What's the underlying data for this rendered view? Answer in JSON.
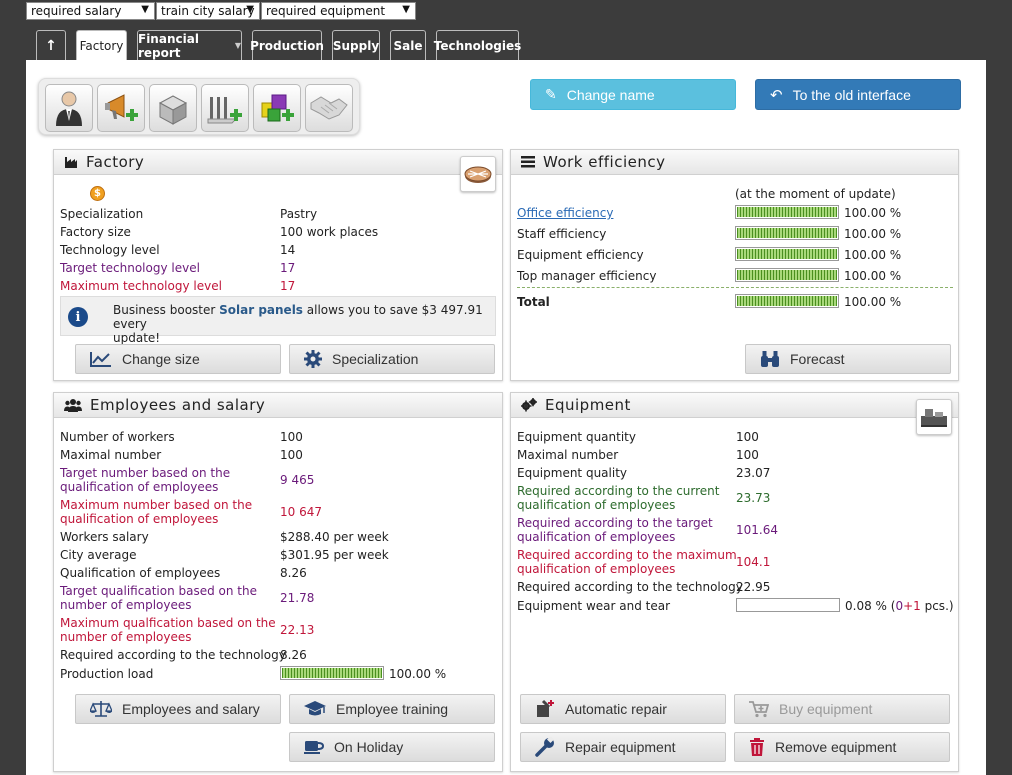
{
  "filters": [
    "required salary",
    "train city salary",
    "required equipment"
  ],
  "tabs": {
    "up_arrow": "↑",
    "items": [
      "Factory",
      "Financial report",
      "Production",
      "Supply",
      "Sale",
      "Technologies"
    ],
    "active": "Factory"
  },
  "toolbar_icons": [
    "manager-icon",
    "advertising-icon",
    "warehouse-icon",
    "equipment-add-icon",
    "product-add-icon",
    "handshake-icon"
  ],
  "top_buttons": {
    "change_name": "Change name",
    "old_interface": "To the old interface"
  },
  "factory": {
    "title": "Factory",
    "rows": [
      {
        "label": "Specialization",
        "value": "Pastry"
      },
      {
        "label": "Factory size",
        "value": "100 work places"
      },
      {
        "label": "Technology level",
        "value": "14"
      },
      {
        "label": "Target technology level",
        "value": "17"
      },
      {
        "label": "Maximum technology level",
        "value": "17"
      }
    ],
    "booster_prefix": "Business booster ",
    "booster_name": "Solar panels",
    "booster_suffix": " allows you to save $3 497.91 every",
    "booster_line2": "update!",
    "btn_change_size": "Change size",
    "btn_specialization": "Specialization"
  },
  "efficiency": {
    "title": "Work efficiency",
    "note": "(at the moment of update)",
    "rows": [
      {
        "label": "Office efficiency",
        "value": "100.00 %",
        "level": 1.0
      },
      {
        "label": "Staff efficiency",
        "value": "100.00 %",
        "level": 1.0
      },
      {
        "label": "Equipment efficiency",
        "value": "100.00 %",
        "level": 1.0
      },
      {
        "label": "Top manager efficiency",
        "value": "100.00 %",
        "level": 1.0
      }
    ],
    "total_label": "Total",
    "total_value": "100.00 %",
    "total_level": 1.0,
    "btn_forecast": "Forecast"
  },
  "employees": {
    "title": "Employees and salary",
    "rows": [
      {
        "label": "Number of workers",
        "value": "100"
      },
      {
        "label": "Maximal number",
        "value": "100"
      },
      {
        "label": "Target number based on the",
        "label2": "qualification of employees",
        "value": "9 465"
      },
      {
        "label": "Maximum number based on the",
        "label2": "qualification of employees",
        "value": "10 647"
      },
      {
        "label": "Workers salary",
        "value": "$288.40 per week"
      },
      {
        "label": "City average",
        "value": "$301.95 per week"
      },
      {
        "label": "Qualification of employees",
        "value": "8.26"
      },
      {
        "label": "Target qualification based on the",
        "label2": "number of employees",
        "value": "21.78"
      },
      {
        "label": "Maximum qualfication based on the",
        "label2": "number of employees",
        "value": "22.13"
      },
      {
        "label": "Required according to the technology",
        "value": "8.26"
      }
    ],
    "load_label": "Production load",
    "load_value": "100.00 %",
    "load_level": 1.0,
    "btn_employees": "Employees and salary",
    "btn_training": "Employee training",
    "btn_holiday": "On Holiday"
  },
  "equipment": {
    "title": "Equipment",
    "rows": [
      {
        "label": "Equipment quantity",
        "value": "100"
      },
      {
        "label": "Maximal number",
        "value": "100"
      },
      {
        "label": "Equipment quality",
        "value": "23.07"
      },
      {
        "label": "Required according to the current",
        "label2": "qualification of employees",
        "value": "23.73"
      },
      {
        "label": "Required according to the target",
        "label2": "qualification of employees",
        "value": "101.64"
      },
      {
        "label": "Required according to the maximum",
        "label2": "qualification of employees",
        "value": "104.1"
      },
      {
        "label": "Required according to the technology",
        "value": "22.95"
      }
    ],
    "wear_label": "Equipment wear and tear",
    "wear_value": "0.08 %",
    "wear_open": " (",
    "wear_zero": "0",
    "wear_plus": "+1",
    "wear_close": " pcs.)",
    "wear_level": 0.0008,
    "btn_auto_repair": "Automatic repair",
    "btn_buy": "Buy equipment",
    "btn_repair": "Repair equipment",
    "btn_remove": "Remove equipment"
  },
  "colors": {
    "change_name_bg": "#5bc0de",
    "old_interface_bg": "#337ab7",
    "purple": "#6a1a7a",
    "red": "#c0163a",
    "green": "#2d6b2d"
  }
}
